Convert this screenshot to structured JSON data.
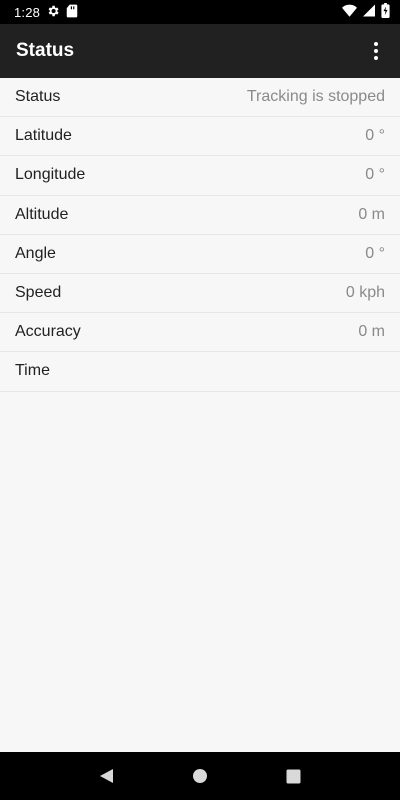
{
  "status_bar": {
    "time": "1:28",
    "icons": [
      "gear-icon",
      "sd-card-icon",
      "wifi-icon",
      "signal-icon",
      "battery-charging-icon"
    ]
  },
  "app_bar": {
    "title": "Status",
    "overflow_icon": "more-vert-icon"
  },
  "rows": [
    {
      "label": "Status",
      "value": "Tracking is stopped"
    },
    {
      "label": "Latitude",
      "value": "0 °"
    },
    {
      "label": "Longitude",
      "value": "0 °"
    },
    {
      "label": "Altitude",
      "value": "0 m"
    },
    {
      "label": "Angle",
      "value": "0 °"
    },
    {
      "label": "Speed",
      "value": "0 kph"
    },
    {
      "label": "Accuracy",
      "value": "0 m"
    },
    {
      "label": "Time",
      "value": ""
    }
  ],
  "nav_bar": {
    "icons": [
      "back-icon",
      "home-icon",
      "recents-icon"
    ]
  },
  "colors": {
    "app_bar_bg": "#212121",
    "status_bar_bg": "#000000",
    "list_bg": "#f7f7f7",
    "value_text": "#8a8a8a"
  }
}
